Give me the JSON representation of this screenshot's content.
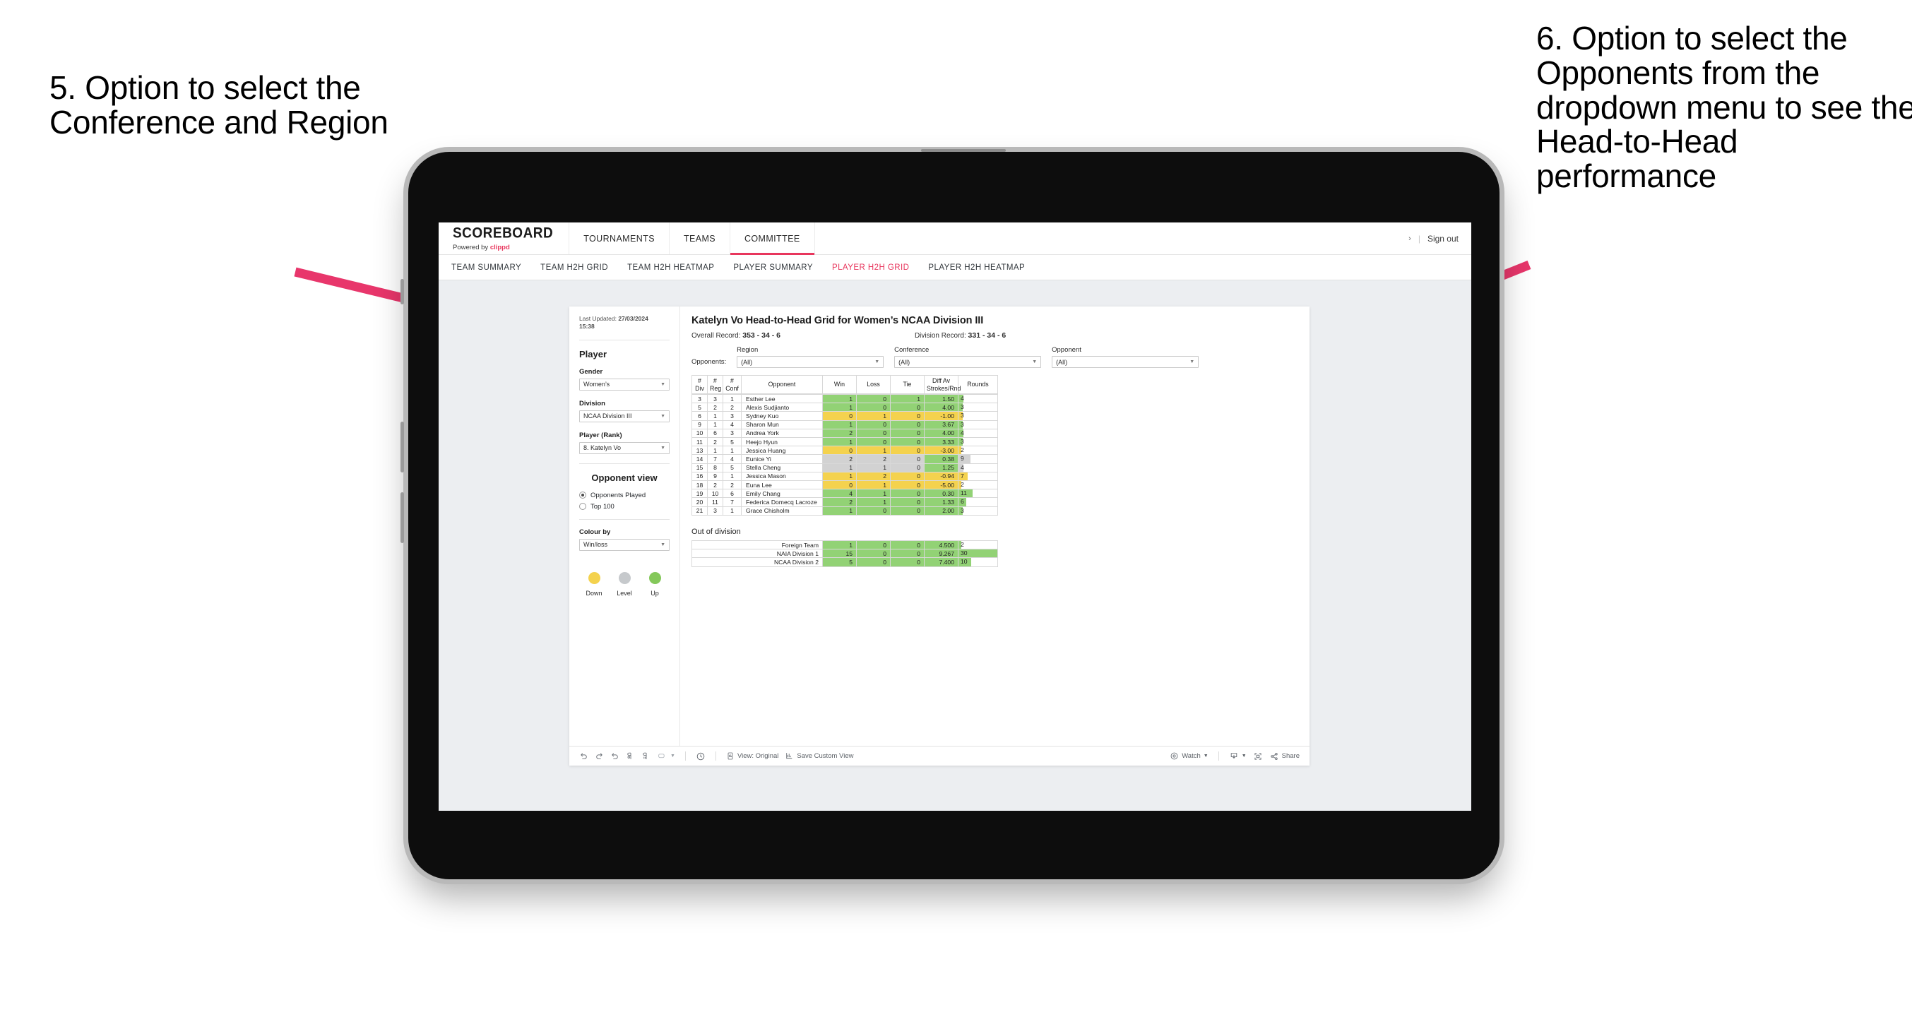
{
  "annotations": {
    "left": "5. Option to select the Conference and Region",
    "right": "6. Option to select the Opponents from the dropdown menu to see the Head-to-Head performance",
    "arrow_color": "#E8366B"
  },
  "app": {
    "brand": {
      "name": "SCOREBOARD",
      "powered_prefix": "Powered by",
      "powered_brand": "clippd"
    },
    "top_nav": [
      {
        "label": "TOURNAMENTS",
        "active": false
      },
      {
        "label": "TEAMS",
        "active": false
      },
      {
        "label": "COMMITTEE",
        "active": true
      }
    ],
    "top_right": {
      "chevron": "›",
      "separator": "|",
      "sign_out": "Sign out"
    },
    "sub_nav": [
      {
        "label": "TEAM SUMMARY",
        "active": false
      },
      {
        "label": "TEAM H2H GRID",
        "active": false
      },
      {
        "label": "TEAM H2H HEATMAP",
        "active": false
      },
      {
        "label": "PLAYER SUMMARY",
        "active": false
      },
      {
        "label": "PLAYER H2H GRID",
        "active": true
      },
      {
        "label": "PLAYER H2H HEATMAP",
        "active": false
      }
    ],
    "accent_color": "#E8365D"
  },
  "sidebar": {
    "last_updated_label": "Last Updated:",
    "last_updated_value": "27/03/2024",
    "last_updated_time": "15:38",
    "player_heading": "Player",
    "fields": [
      {
        "label": "Gender",
        "value": "Women’s"
      },
      {
        "label": "Division",
        "value": "NCAA Division III"
      },
      {
        "label": "Player (Rank)",
        "value": "8. Katelyn Vo"
      }
    ],
    "opponent_view": {
      "heading": "Opponent view",
      "options": [
        {
          "label": "Opponents Played",
          "selected": true
        },
        {
          "label": "Top 100",
          "selected": false
        }
      ]
    },
    "colour_by": {
      "label": "Colour by",
      "value": "Win/loss"
    },
    "legend": [
      {
        "label": "Down",
        "color": "#F4D24E"
      },
      {
        "label": "Level",
        "color": "#C6C9CC"
      },
      {
        "label": "Up",
        "color": "#84C85A"
      }
    ]
  },
  "main": {
    "title": "Katelyn Vo Head-to-Head Grid for Women’s NCAA Division III",
    "overall_record_label": "Overall Record:",
    "overall_record_value": "353 - 34 - 6",
    "division_record_label": "Division Record:",
    "division_record_value": "331 - 34 - 6",
    "filters_lead": "Opponents:",
    "filters": [
      {
        "label": "Region",
        "value": "(All)"
      },
      {
        "label": "Conference",
        "value": "(All)"
      },
      {
        "label": "Opponent",
        "value": "(All)"
      }
    ],
    "columns": [
      "# Div",
      "# Reg",
      "# Conf",
      "Opponent",
      "Win",
      "Loss",
      "Tie",
      "Diff Av Strokes/Rnd",
      "Rounds"
    ],
    "columns_two_line": [
      {
        "top": "#",
        "bottom": "Div"
      },
      {
        "top": "#",
        "bottom": "Reg"
      },
      {
        "top": "#",
        "bottom": "Conf"
      },
      {
        "top": "Opponent",
        "bottom": ""
      },
      {
        "top": "Win",
        "bottom": ""
      },
      {
        "top": "Loss",
        "bottom": ""
      },
      {
        "top": "Tie",
        "bottom": ""
      },
      {
        "top": "Diff Av",
        "bottom": "Strokes/Rnd"
      },
      {
        "top": "Rounds",
        "bottom": ""
      }
    ],
    "out_of_division_heading": "Out of division"
  },
  "chart_data": {
    "type": "table",
    "title": "Katelyn Vo Head-to-Head Grid for Women’s NCAA Division III",
    "columns": [
      "# Div",
      "# Reg",
      "# Conf",
      "Opponent",
      "Win",
      "Loss",
      "Tie",
      "Diff Av Strokes/Rnd",
      "Rounds"
    ],
    "rounds_max": 30,
    "colour_scale": {
      "up": "#92D275",
      "down": "#F4D24E",
      "level": "#D2D2D2"
    },
    "rows": [
      {
        "div": "3",
        "reg": "3",
        "conf": "1",
        "opponent": "Esther Lee",
        "win": "1",
        "loss": "0",
        "tie": "1",
        "diff": "1.50",
        "rounds": 4,
        "state": "up"
      },
      {
        "div": "5",
        "reg": "2",
        "conf": "2",
        "opponent": "Alexis Sudjianto",
        "win": "1",
        "loss": "0",
        "tie": "0",
        "diff": "4.00",
        "rounds": 3,
        "state": "up"
      },
      {
        "div": "6",
        "reg": "1",
        "conf": "3",
        "opponent": "Sydney Kuo",
        "win": "0",
        "loss": "1",
        "tie": "0",
        "diff": "-1.00",
        "rounds": 3,
        "state": "down"
      },
      {
        "div": "9",
        "reg": "1",
        "conf": "4",
        "opponent": "Sharon Mun",
        "win": "1",
        "loss": "0",
        "tie": "0",
        "diff": "3.67",
        "rounds": 3,
        "state": "up"
      },
      {
        "div": "10",
        "reg": "6",
        "conf": "3",
        "opponent": "Andrea York",
        "win": "2",
        "loss": "0",
        "tie": "0",
        "diff": "4.00",
        "rounds": 4,
        "state": "up"
      },
      {
        "div": "11",
        "reg": "2",
        "conf": "5",
        "opponent": "Heejo Hyun",
        "win": "1",
        "loss": "0",
        "tie": "0",
        "diff": "3.33",
        "rounds": 3,
        "state": "up"
      },
      {
        "div": "13",
        "reg": "1",
        "conf": "1",
        "opponent": "Jessica Huang",
        "win": "0",
        "loss": "1",
        "tie": "0",
        "diff": "-3.00",
        "rounds": 2,
        "state": "down"
      },
      {
        "div": "14",
        "reg": "7",
        "conf": "4",
        "opponent": "Eunice Yi",
        "win": "2",
        "loss": "2",
        "tie": "0",
        "diff": "0.38",
        "rounds": 9,
        "state": "level",
        "diff_state": "up"
      },
      {
        "div": "15",
        "reg": "8",
        "conf": "5",
        "opponent": "Stella Cheng",
        "win": "1",
        "loss": "1",
        "tie": "0",
        "diff": "1.25",
        "rounds": 4,
        "state": "level",
        "diff_state": "up"
      },
      {
        "div": "16",
        "reg": "9",
        "conf": "1",
        "opponent": "Jessica Mason",
        "win": "1",
        "loss": "2",
        "tie": "0",
        "diff": "-0.94",
        "rounds": 7,
        "state": "down"
      },
      {
        "div": "18",
        "reg": "2",
        "conf": "2",
        "opponent": "Euna Lee",
        "win": "0",
        "loss": "1",
        "tie": "0",
        "diff": "-5.00",
        "rounds": 2,
        "state": "down"
      },
      {
        "div": "19",
        "reg": "10",
        "conf": "6",
        "opponent": "Emily Chang",
        "win": "4",
        "loss": "1",
        "tie": "0",
        "diff": "0.30",
        "rounds": 11,
        "state": "up"
      },
      {
        "div": "20",
        "reg": "11",
        "conf": "7",
        "opponent": "Federica Domecq Lacroze",
        "win": "2",
        "loss": "1",
        "tie": "0",
        "diff": "1.33",
        "rounds": 6,
        "state": "up"
      }
    ],
    "out_of_division": [
      {
        "opponent": "Foreign Team",
        "win": "1",
        "loss": "0",
        "tie": "0",
        "diff": "4.500",
        "rounds": 2,
        "state": "up"
      },
      {
        "opponent": "NAIA Division 1",
        "win": "15",
        "loss": "0",
        "tie": "0",
        "diff": "9.267",
        "rounds": 30,
        "state": "up"
      },
      {
        "opponent": "NCAA Division 2",
        "win": "5",
        "loss": "0",
        "tie": "0",
        "diff": "7.400",
        "rounds": 10,
        "state": "up"
      }
    ]
  },
  "toolbar": {
    "view_label": "View: Original",
    "save_label": "Save Custom View",
    "watch_label": "Watch",
    "share_label": "Share"
  }
}
